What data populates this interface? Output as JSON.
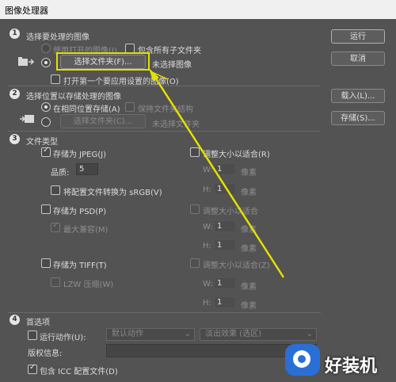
{
  "window": {
    "title": "图像处理器"
  },
  "side_buttons": {
    "run": "运行",
    "cancel": "取消",
    "load": "载入(L)...",
    "save": "存储(S)..."
  },
  "section1": {
    "num": "1",
    "title": "选择要处理的图像",
    "use_open": "使用打开的图像(I)",
    "include_subfolders": "包含所有子文件夹",
    "select_folder_btn": "选择文件夹(F)...",
    "folder_status": "未选择图像",
    "open_first": "打开第一个要应用设置的图像(O)"
  },
  "section2": {
    "num": "2",
    "title": "选择位置以存储处理的图像",
    "same_location": "在相同位置存储(A)",
    "keep_structure": "保持文件夹结构",
    "select_folder_btn": "选择文件夹(C)...",
    "folder_status": "未选择文件夹"
  },
  "section3": {
    "num": "3",
    "title": "文件类型",
    "jpeg": {
      "save_as": "存储为 JPEG(J)",
      "resize": "调整大小以适合(R)",
      "quality_label": "品质:",
      "quality_value": "5",
      "convert_srgb": "将配置文件转换为 sRGB(V)",
      "w_label": "W:",
      "w_value": "1",
      "h_label": "H:",
      "h_value": "1",
      "unit": "像素"
    },
    "psd": {
      "save_as": "存储为 PSD(P)",
      "resize": "调整大小以适合",
      "max_compat": "最大兼容(M)",
      "w_label": "W:",
      "w_value": "1",
      "h_label": "H:",
      "h_value": "1",
      "unit": "像素"
    },
    "tiff": {
      "save_as": "存储为 TIFF(T)",
      "resize": "调整大小以适合(Z)",
      "lzw": "LZW 压缩(W)",
      "w_label": "W:",
      "w_value": "1",
      "h_label": "H:",
      "h_value": "1",
      "unit": "像素"
    }
  },
  "section4": {
    "num": "4",
    "title": "首选项",
    "run_action": "运行动作(U):",
    "action_set": "默认动作",
    "action": "淡出效果 (选区)",
    "copyright_label": "版权信息:",
    "copyright_value": "",
    "include_icc": "包含 ICC 配置文件(D)"
  },
  "watermark": {
    "text": "好装机"
  },
  "colors": {
    "highlight": "#e4e000",
    "background": "#535353"
  }
}
